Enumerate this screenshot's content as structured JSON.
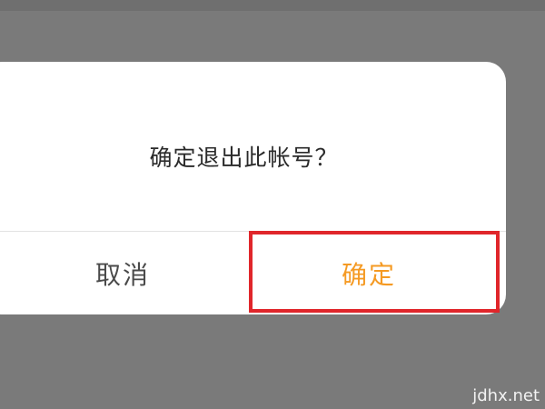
{
  "dialog": {
    "message": "确定退出此帐号？",
    "cancel_label": "取消",
    "confirm_label": "确定"
  },
  "watermark": "jdhx.net",
  "colors": {
    "overlay": "#7a7a7a",
    "dialog_background": "#ffffff",
    "confirm_text": "#f59a23",
    "cancel_text": "#4a4a4a",
    "highlight_border": "#e0262b"
  }
}
